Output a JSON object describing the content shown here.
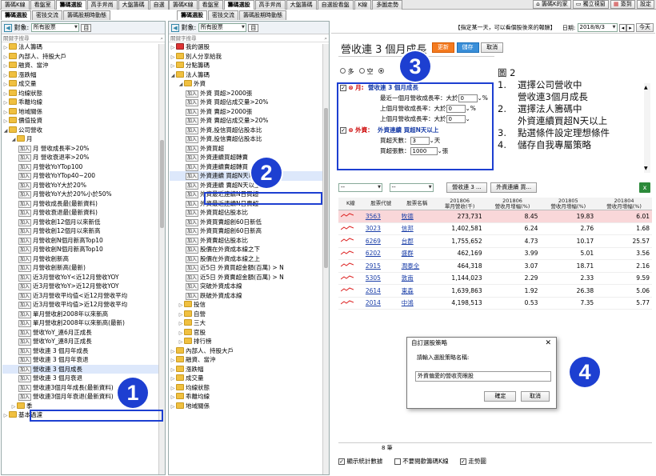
{
  "top_tabs_left": [
    "籌碼K線",
    "看盤室",
    "籌碼選股",
    "高手斧尚",
    "大盤籌碼",
    "自選"
  ],
  "top_tabs_right": [
    "籌碼K線",
    "看盤室",
    "籌碼選股",
    "高手斧尚",
    "大盤籌碼",
    "自選股看盤",
    "K線",
    "多圖走勢"
  ],
  "header_right": {
    "home": "籌碼K的家",
    "window": "獨立視窗",
    "signin": "簽到",
    "settings": "設定"
  },
  "sub_tabs": [
    "籌碼選股",
    "密技交流",
    "籌碼股期時動態"
  ],
  "left_panel": {
    "target_label": "對象:",
    "target_value": "所有股票",
    "target_btn": "目",
    "header": "關鍵字搜尋",
    "items": [
      {
        "t": "法人籌碼",
        "lv": 0,
        "k": "f",
        "tw": "▷"
      },
      {
        "t": "內部人、持股大戶",
        "lv": 0,
        "k": "f",
        "tw": "▷"
      },
      {
        "t": "融資、當沖",
        "lv": 0,
        "k": "f",
        "tw": "▷"
      },
      {
        "t": "漲跌幅",
        "lv": 0,
        "k": "f",
        "tw": "▷"
      },
      {
        "t": "成交量",
        "lv": 0,
        "k": "f",
        "tw": "▷"
      },
      {
        "t": "均線狀態",
        "lv": 0,
        "k": "f",
        "tw": "▷"
      },
      {
        "t": "乖離均線",
        "lv": 0,
        "k": "f",
        "tw": "▷"
      },
      {
        "t": "地域關係",
        "lv": 0,
        "k": "f",
        "tw": "▷"
      },
      {
        "t": "價值投資",
        "lv": 0,
        "k": "f",
        "tw": "▷"
      },
      {
        "t": "公司營收",
        "lv": 0,
        "k": "f",
        "tw": "◢"
      },
      {
        "t": "月",
        "lv": 1,
        "k": "f",
        "tw": "◢"
      },
      {
        "t": "月 營收成長率>20%",
        "lv": 2,
        "k": "i"
      },
      {
        "t": "月 營收衰退率>20%",
        "lv": 2,
        "k": "i"
      },
      {
        "t": "月營收YoYTop100",
        "lv": 2,
        "k": "i"
      },
      {
        "t": "月營收YoYTop40~200",
        "lv": 2,
        "k": "i"
      },
      {
        "t": "月營收YoY大於20%",
        "lv": 2,
        "k": "i"
      },
      {
        "t": "月營收YoY大於20%小於50%",
        "lv": 2,
        "k": "i"
      },
      {
        "t": "月營收成長最(最新資料)",
        "lv": 2,
        "k": "i"
      },
      {
        "t": "月營收衰退最(最新資料)",
        "lv": 2,
        "k": "i"
      },
      {
        "t": "月營收創12個月以來新低",
        "lv": 2,
        "k": "i"
      },
      {
        "t": "月營收創12個月以來新高",
        "lv": 2,
        "k": "i"
      },
      {
        "t": "月營收創N個月新高Top10",
        "lv": 2,
        "k": "i"
      },
      {
        "t": "月營收創N個月新高Top10",
        "lv": 2,
        "k": "i"
      },
      {
        "t": "月營收創新高",
        "lv": 2,
        "k": "i"
      },
      {
        "t": "月營收創新高(最新)",
        "lv": 2,
        "k": "i"
      },
      {
        "t": "近3月營收YoY<近12月營收YOY",
        "lv": 2,
        "k": "i"
      },
      {
        "t": "近3月營收YoY>近12月營收YOY",
        "lv": 2,
        "k": "i"
      },
      {
        "t": "近3月營收平均值<近12月營收平均",
        "lv": 2,
        "k": "i"
      },
      {
        "t": "近3月營收平均值>近12月營收平均",
        "lv": 2,
        "k": "i"
      },
      {
        "t": "單月營收創2008年以來新高",
        "lv": 2,
        "k": "i"
      },
      {
        "t": "單月營收創2008年以來新高(最新)",
        "lv": 2,
        "k": "i"
      },
      {
        "t": "營收YoY_連6月正成長",
        "lv": 2,
        "k": "i"
      },
      {
        "t": "營收YoY_連8月正成長",
        "lv": 2,
        "k": "i"
      },
      {
        "t": "營收連 3 個月年成長",
        "lv": 2,
        "k": "i"
      },
      {
        "t": "營收連 3 個月年衰退",
        "lv": 2,
        "k": "i"
      },
      {
        "t": "營收連 3 個月成長",
        "lv": 2,
        "k": "i",
        "sel": true
      },
      {
        "t": "營收連 3 個月衰退",
        "lv": 2,
        "k": "i"
      },
      {
        "t": "營收連3個月年成長(最新資料)",
        "lv": 2,
        "k": "i"
      },
      {
        "t": "營收連3個月年衰退(最新資料)",
        "lv": 2,
        "k": "i"
      },
      {
        "t": "季",
        "lv": 1,
        "k": "f",
        "tw": "▷"
      },
      {
        "t": "基本過濾",
        "lv": 0,
        "k": "f",
        "tw": "▷"
      }
    ]
  },
  "mid_panel": {
    "target_label": "對象:",
    "target_value": "所有股票",
    "target_btn": "目",
    "header": "關鍵字搜尋",
    "items": [
      {
        "t": "我的選股",
        "lv": 0,
        "k": "r",
        "tw": "▷"
      },
      {
        "t": "別人分享給我",
        "lv": 0,
        "k": "f",
        "tw": "▷"
      },
      {
        "t": "分點籌碼",
        "lv": 0,
        "k": "f",
        "tw": "▷"
      },
      {
        "t": "法人籌碼",
        "lv": 0,
        "k": "f",
        "tw": "◢"
      },
      {
        "t": "外資",
        "lv": 1,
        "k": "f",
        "tw": "◢"
      },
      {
        "t": "外資 買超>2000張",
        "lv": 2,
        "k": "i"
      },
      {
        "t": "外資 買超佔成交量>20%",
        "lv": 2,
        "k": "i"
      },
      {
        "t": "外資 賣超>2000張",
        "lv": 2,
        "k": "i"
      },
      {
        "t": "外資 賣超佔成交量>20%",
        "lv": 2,
        "k": "i"
      },
      {
        "t": "外資,投信買超佔股本比",
        "lv": 2,
        "k": "i"
      },
      {
        "t": "外資,投信賣超佔股本比",
        "lv": 2,
        "k": "i"
      },
      {
        "t": "外資買超",
        "lv": 2,
        "k": "i"
      },
      {
        "t": "外資連續買超轉賣",
        "lv": 2,
        "k": "i"
      },
      {
        "t": "外資連續賣超轉買",
        "lv": 2,
        "k": "i"
      },
      {
        "t": "外資連續 買超N天以上",
        "lv": 2,
        "k": "i",
        "sel": true
      },
      {
        "t": "外資連續 賣超N天以上",
        "lv": 2,
        "k": "i"
      },
      {
        "t": "外資最近連續N日買超",
        "lv": 2,
        "k": "i"
      },
      {
        "t": "外資最近連續N日賣超",
        "lv": 2,
        "k": "i"
      },
      {
        "t": "外資買超佔股本比",
        "lv": 2,
        "k": "i"
      },
      {
        "t": "外資買賣超創60日新低",
        "lv": 2,
        "k": "i"
      },
      {
        "t": "外資買賣超創60日新高",
        "lv": 2,
        "k": "i"
      },
      {
        "t": "外資賣超佔股本比",
        "lv": 2,
        "k": "i"
      },
      {
        "t": "股價在外資成本線之下",
        "lv": 2,
        "k": "i"
      },
      {
        "t": "股價在外資成本線之上",
        "lv": 2,
        "k": "i"
      },
      {
        "t": "近5日 外資買超金額(百萬) > N",
        "lv": 2,
        "k": "i"
      },
      {
        "t": "近5日 外資賣超金額(百萬) > N",
        "lv": 2,
        "k": "i"
      },
      {
        "t": "突破外資成本線",
        "lv": 2,
        "k": "i"
      },
      {
        "t": "跌破外資成本線",
        "lv": 2,
        "k": "i"
      },
      {
        "t": "投信",
        "lv": 1,
        "k": "f",
        "tw": "▷"
      },
      {
        "t": "自營",
        "lv": 1,
        "k": "f",
        "tw": "▷"
      },
      {
        "t": "三大",
        "lv": 1,
        "k": "f",
        "tw": "▷"
      },
      {
        "t": "官股",
        "lv": 1,
        "k": "f",
        "tw": "▷"
      },
      {
        "t": "排行榜",
        "lv": 1,
        "k": "f",
        "tw": "▷"
      },
      {
        "t": "內部人、持股大戶",
        "lv": 0,
        "k": "f",
        "tw": "▷"
      },
      {
        "t": "融資、當沖",
        "lv": 0,
        "k": "f",
        "tw": "▷"
      },
      {
        "t": "漲跌幅",
        "lv": 0,
        "k": "f",
        "tw": "▷"
      },
      {
        "t": "成交量",
        "lv": 0,
        "k": "f",
        "tw": "▷"
      },
      {
        "t": "均線狀態",
        "lv": 0,
        "k": "f",
        "tw": "▷"
      },
      {
        "t": "乖離均線",
        "lv": 0,
        "k": "f",
        "tw": "▷"
      },
      {
        "t": "地域關係",
        "lv": 0,
        "k": "f",
        "tw": "▷"
      }
    ]
  },
  "right_panel": {
    "hint": "【指定某一天，可以看個股後來的報酬】",
    "date_label": "日期:",
    "date_value": "2018/8/3",
    "today_btn": "今天",
    "title": "營收連 3 個月成長",
    "btn_update": "更新",
    "btn_save": "儲存",
    "btn_cancel": "取消",
    "radios": [
      "多",
      "空"
    ],
    "cond1": {
      "name": "月:",
      "title": "營收連 3 個月成長",
      "rows": [
        {
          "label": "最近一個月營收成長率：大於",
          "value": "0",
          "unit": "%"
        },
        {
          "label": "上個月營收成長率：大於",
          "value": "0",
          "unit": "%"
        },
        {
          "label": "上個月營收成長率：大於",
          "value": "0",
          "unit": ""
        }
      ]
    },
    "cond2": {
      "name": "外資：",
      "title": "外資連續 買超N天以上",
      "rows": [
        {
          "label": "買超天數：",
          "value": "3",
          "unit": "天"
        },
        {
          "label": "買超張數：",
          "value": "1000",
          "unit": "張"
        }
      ]
    },
    "notes": [
      "圖 2",
      "1.",
      "選擇公司營收中",
      "營收連3個月成長",
      "2.",
      "選擇法人籌碼中",
      "外資連續買超N天以上",
      "3.",
      "點選條件設定理想條件",
      "4.",
      "儲存自我專屬策略"
    ],
    "toolbar": {
      "s1": "--",
      "s2": "--",
      "b1": "營收連 3 ...",
      "b2": "外資連續 買..."
    },
    "columns": [
      "K線",
      "股票代號",
      "股票名稱",
      "201806\n單月營收(千)",
      "201806\n營收月增幅(%)",
      "201805\n營收月增幅(%)",
      "201804\n營收月增幅(%)"
    ],
    "rows": [
      {
        "code": "3563",
        "name": "牧德",
        "rev": "273,731",
        "m1": "8.45",
        "m2": "19.83",
        "m3": "6.01",
        "hl": true
      },
      {
        "code": "3023",
        "name": "信邦",
        "rev": "1,402,581",
        "m1": "6.24",
        "m2": "2.76",
        "m3": "1.68"
      },
      {
        "code": "6269",
        "name": "台郡",
        "rev": "1,755,652",
        "m1": "4.73",
        "m2": "10.17",
        "m3": "25.57"
      },
      {
        "code": "6202",
        "name": "盛群",
        "rev": "462,169",
        "m1": "3.99",
        "m2": "5.01",
        "m3": "3.56"
      },
      {
        "code": "2915",
        "name": "潤泰全",
        "rev": "464,318",
        "m1": "3.07",
        "m2": "18.71",
        "m3": "2.16"
      },
      {
        "code": "5305",
        "name": "敦南",
        "rev": "1,144,023",
        "m1": "2.29",
        "m2": "2.33",
        "m3": "9.59"
      },
      {
        "code": "2614",
        "name": "東森",
        "rev": "1,639,863",
        "m1": "1.92",
        "m2": "26.38",
        "m3": "5.06"
      },
      {
        "code": "2014",
        "name": "中鴻",
        "rev": "4,198,513",
        "m1": "0.53",
        "m2": "7.35",
        "m3": "5.77"
      }
    ],
    "count": "8 筆",
    "footer": [
      "顯示統計數據",
      "不要閱歡籌碼K線",
      "走勢圖"
    ]
  },
  "dialog": {
    "title": "自訂選股策略",
    "prompt": "請輸入選股策略名稱:",
    "value": "外資偏愛的營收亮眼股",
    "ok": "確定",
    "cancel": "取消"
  },
  "badges": [
    "1",
    "2",
    "3",
    "4"
  ]
}
